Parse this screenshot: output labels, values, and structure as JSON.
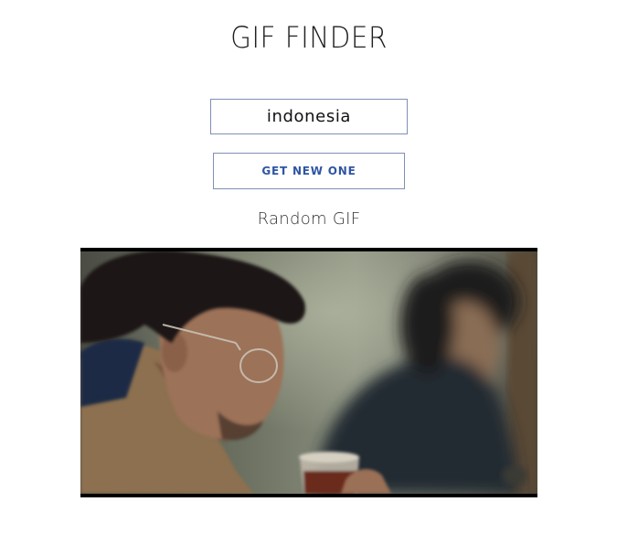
{
  "page": {
    "title": "GIF FINDER",
    "subtitle": "Random GIF"
  },
  "search": {
    "value": "indonesia"
  },
  "actions": {
    "get_new_label": "GET NEW ONE"
  },
  "gif": {
    "alt": "Random GIF"
  },
  "colors": {
    "accent": "#2f55a4",
    "border": "#7f8fb6",
    "text": "#1f1f1f"
  }
}
